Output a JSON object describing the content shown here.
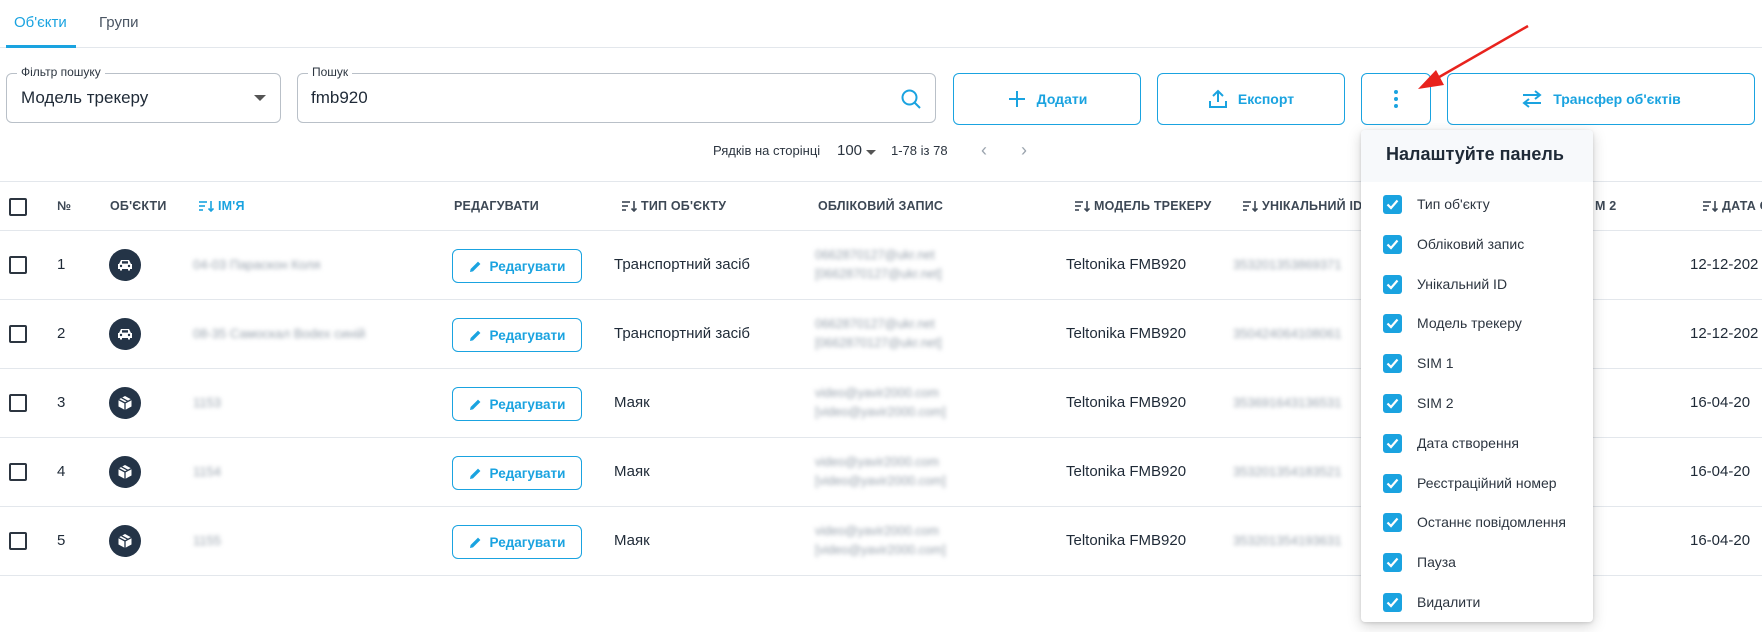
{
  "tabs": [
    {
      "label": "Об'єкти",
      "active": true
    },
    {
      "label": "Групи",
      "active": false
    }
  ],
  "filter": {
    "legend": "Фільтр пошуку",
    "value": "Модель трекеру"
  },
  "search": {
    "legend": "Пошук",
    "value": "fmb920",
    "icon": "search-icon"
  },
  "actions": {
    "add_label": "Додати",
    "export_label": "Експорт",
    "more_icon": "more-vertical-icon",
    "transfer_label": "Трансфер об'єктів"
  },
  "pagination": {
    "rows_label": "Рядків на сторінці",
    "rows_value": "100",
    "range": "1-78 із 78",
    "prev": "‹",
    "next": "›"
  },
  "columns": {
    "num": "№",
    "objects": "ОБ'ЄКТИ",
    "name": "ІМ'Я",
    "edit": "РЕДАГУВАТИ",
    "type": "ТИП ОБ'ЄКТУ",
    "account": "ОБЛІКОВИЙ ЗАПИС",
    "model": "МОДЕЛЬ ТРЕКЕРУ",
    "unique": "УНІКАЛЬНИЙ ID",
    "sim2": "M 2",
    "date": "ДАТА С"
  },
  "edit_label": "Редагувати",
  "rows": [
    {
      "num": "1",
      "icon": "car-icon",
      "name": "04-03 Параскон Коля",
      "type": "Транспортний засіб",
      "account1": "0662870127@ukr.net",
      "account2": "[0662870127@ukr.net]",
      "model": "Teltonika FMB920",
      "unique": "353201353869371",
      "date": "12-12-202"
    },
    {
      "num": "2",
      "icon": "car-icon",
      "name": "08-35 Самоскал Bodex синій",
      "type": "Транспортний засіб",
      "account1": "0662870127@ukr.net",
      "account2": "[0662870127@ukr.net]",
      "model": "Teltonika FMB920",
      "unique": "350424064108061",
      "date": "12-12-202"
    },
    {
      "num": "3",
      "icon": "package-icon",
      "name": "1153",
      "type": "Маяк",
      "account1": "video@yavir2000.com",
      "account2": "[video@yavir2000.com]",
      "model": "Teltonika FMB920",
      "unique": "353691643136531",
      "date": "16-04-20"
    },
    {
      "num": "4",
      "icon": "package-icon",
      "name": "1154",
      "type": "Маяк",
      "account1": "video@yavir2000.com",
      "account2": "[video@yavir2000.com]",
      "model": "Teltonika FMB920",
      "unique": "353201354183521",
      "date": "16-04-20"
    },
    {
      "num": "5",
      "icon": "package-icon",
      "name": "1155",
      "type": "Маяк",
      "account1": "video@yavir2000.com",
      "account2": "[video@yavir2000.com]",
      "model": "Teltonika FMB920",
      "unique": "353201354193631",
      "date": "16-04-20"
    }
  ],
  "panel": {
    "title": "Налаштуйте панель",
    "items": [
      {
        "label": "Тип об'єкту",
        "checked": true
      },
      {
        "label": "Обліковий запис",
        "checked": true
      },
      {
        "label": "Унікальний ID",
        "checked": true
      },
      {
        "label": "Модель трекеру",
        "checked": true
      },
      {
        "label": "SIM 1",
        "checked": true
      },
      {
        "label": "SIM 2",
        "checked": true
      },
      {
        "label": "Дата створення",
        "checked": true
      },
      {
        "label": "Реєстраційний номер",
        "checked": true
      },
      {
        "label": "Останнє повідомлення",
        "checked": true
      },
      {
        "label": "Пауза",
        "checked": true
      },
      {
        "label": "Видалити",
        "checked": true
      }
    ]
  },
  "colors": {
    "accent": "#1aa3e0",
    "dark": "#243447",
    "annotation": "#e8231d"
  }
}
